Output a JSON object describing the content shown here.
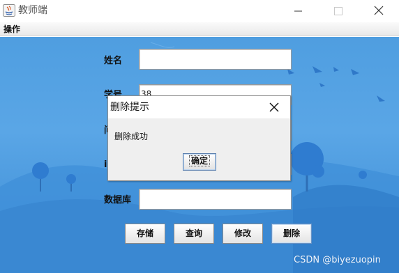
{
  "window": {
    "title": "教师端"
  },
  "menu": {
    "items": [
      "操作"
    ]
  },
  "form": {
    "name_label": "姓名",
    "name_value": "",
    "id_label": "学号",
    "id_value": "38",
    "field3_label": "问",
    "field4_label": "id",
    "db_label": "数据库",
    "db_value": ""
  },
  "buttons": {
    "save": "存储",
    "query": "查询",
    "modify": "修改",
    "delete": "删除"
  },
  "dialog": {
    "title": "删除提示",
    "message": "删除成功",
    "ok": "确定"
  },
  "watermark": "CSDN @biyezuopin",
  "colors": {
    "background_blue": "#4f9ee0",
    "dialog_gray": "#efefef"
  }
}
